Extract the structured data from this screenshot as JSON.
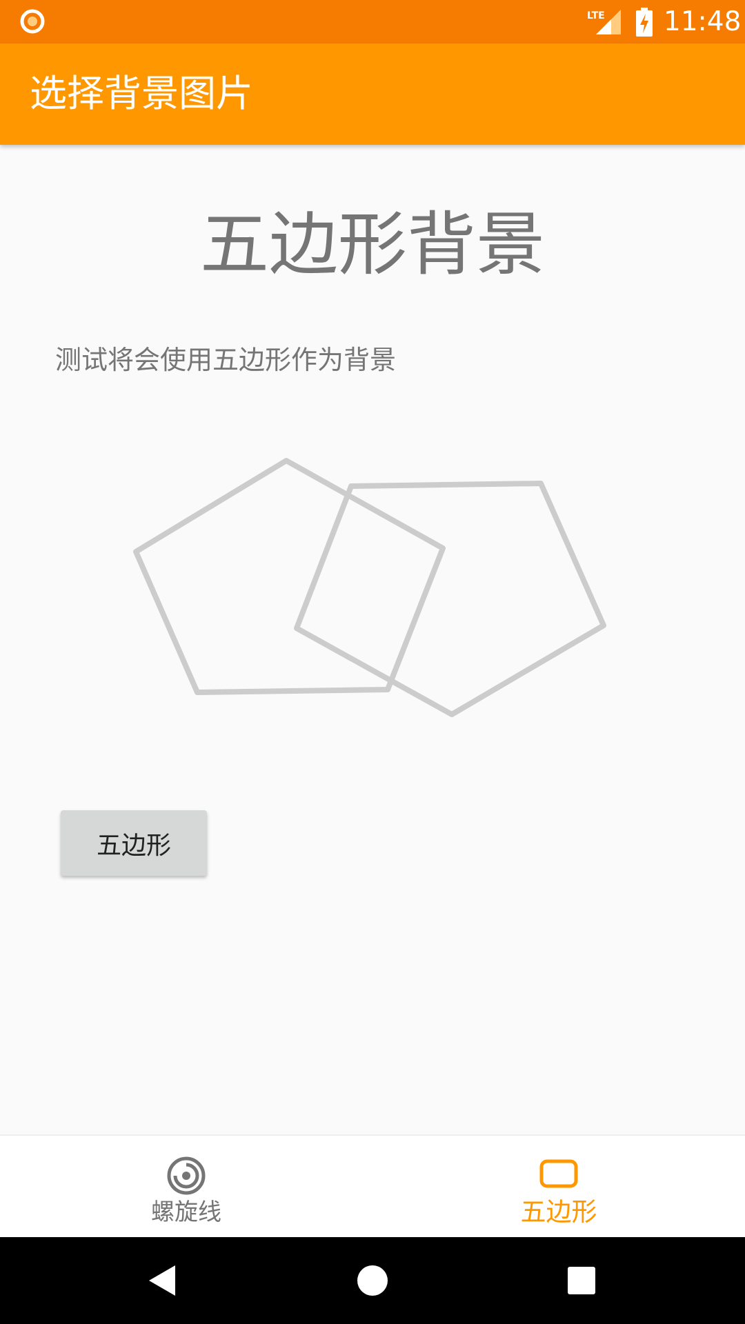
{
  "status_bar": {
    "time": "11:48",
    "network_label": "LTE",
    "notification_icon": "record-dot-icon",
    "signal_icon": "signal-icon",
    "battery_icon": "battery-charging-icon",
    "background_color": "#f57c00"
  },
  "app_bar": {
    "title": "选择背景图片",
    "background_color": "#ff9800"
  },
  "content": {
    "heading": "五边形背景",
    "description": "测试将会使用五边形作为背景",
    "illustration_icon": "two-pentagons-outline",
    "button_label": "五边形"
  },
  "bottom_nav": {
    "items": [
      {
        "label": "螺旋线",
        "icon": "spiral-icon",
        "selected": false
      },
      {
        "label": "五边形",
        "icon": "pentagon-tab-icon",
        "selected": true
      }
    ],
    "active_color": "#ff9800",
    "inactive_color": "#757575"
  },
  "system_nav": {
    "back_icon": "back-triangle-icon",
    "home_icon": "home-circle-icon",
    "recents_icon": "recents-square-icon"
  }
}
